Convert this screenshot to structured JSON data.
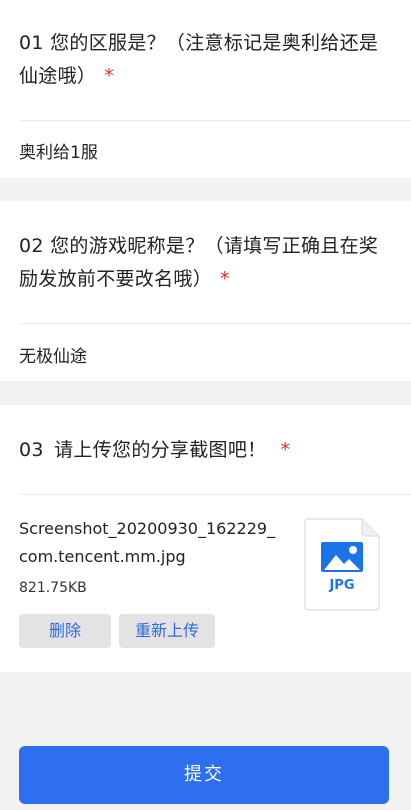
{
  "questions": [
    {
      "number": "01",
      "title": "您的区服是？（注意标记是奥利给还是仙途哦）",
      "required_mark": "*",
      "answer": "奥利给1服"
    },
    {
      "number": "02",
      "title": "您的游戏昵称是？（请填写正确且在奖励发放前不要改名哦）",
      "required_mark": "*",
      "answer": "无极仙途"
    },
    {
      "number": "03",
      "title": "请上传您的分享截图吧！",
      "required_mark": "*"
    }
  ],
  "upload": {
    "file_name": "Screenshot_20200930_162229_com.tencent.mm.jpg",
    "file_size": "821.75KB",
    "file_type": "JPG",
    "icon": "jpg-file-icon",
    "delete_label": "删除",
    "reupload_label": "重新上传"
  },
  "submit_label": "提交",
  "colors": {
    "accent": "#2e6ff0",
    "required": "#e0302a",
    "link": "#2f6ad9",
    "file_icon": "#1a73e8"
  }
}
